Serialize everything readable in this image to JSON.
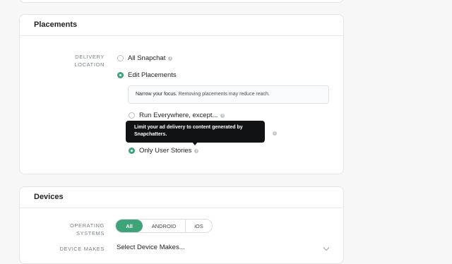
{
  "placements": {
    "title": "Placements",
    "delivery_label_1": "DELIVERY",
    "delivery_label_2": "LOCATION",
    "options": {
      "all_snapchat": "All Snapchat",
      "edit_placements": "Edit Placements",
      "run_everywhere": "Run Everywhere, except...",
      "only_user_stories": "Only User Stories"
    },
    "note_strong": "Narrow your focus.",
    "note_text": " Removing placements may reduce reach.",
    "tooltip_line1": "Limit your ad delivery to content generated by",
    "tooltip_line2": "Snapchatters.",
    "info_glyph": "i"
  },
  "devices": {
    "title": "Devices",
    "os_label_1": "OPERATING",
    "os_label_2": "SYSTEMS",
    "os_options": [
      "All",
      "ANDROID",
      "iOS"
    ],
    "makes_label": "DEVICE MAKES",
    "makes_value": "Select Device Makes..."
  },
  "colors": {
    "accent": "#3fa37a",
    "tooltip_bg": "#111214"
  }
}
